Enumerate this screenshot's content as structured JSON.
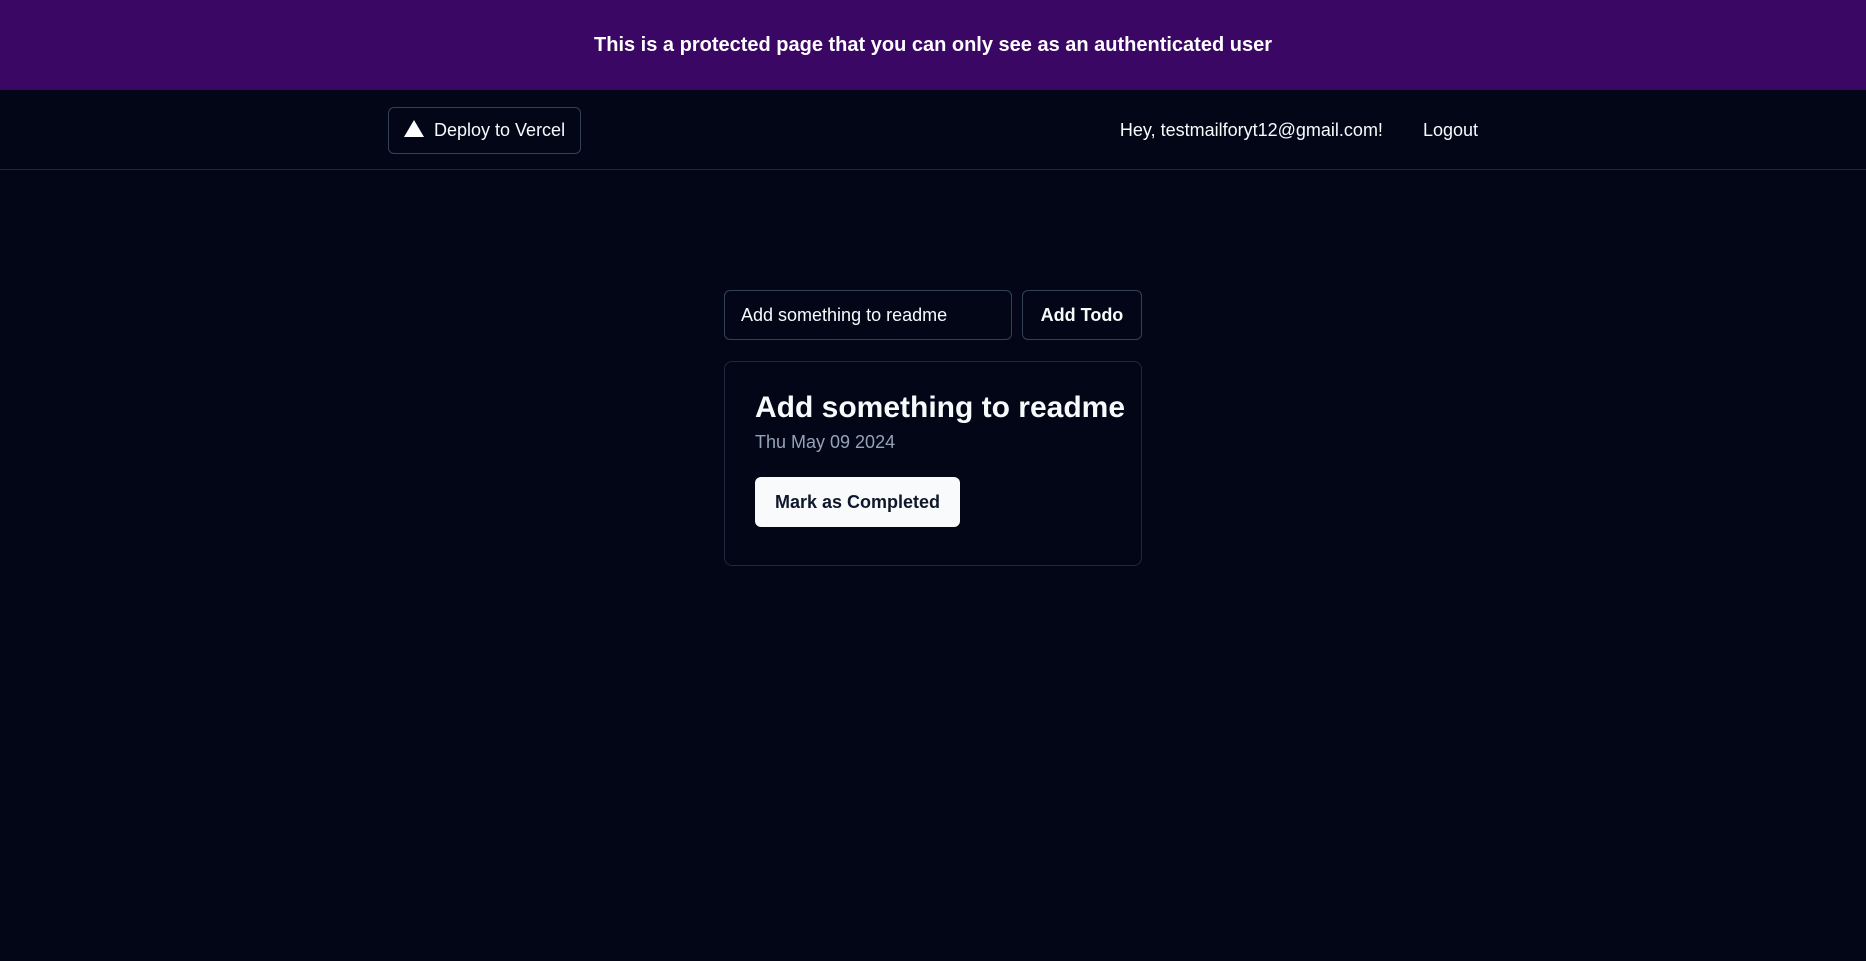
{
  "banner": {
    "text": "This is a protected page that you can only see as an authenticated user"
  },
  "navbar": {
    "deploy_label": "Deploy to Vercel",
    "deploy_icon": "triangle-icon",
    "greeting": "Hey, testmailforyt12@gmail.com!",
    "logout_label": "Logout"
  },
  "todo_form": {
    "input_value": "Add something to readme",
    "add_label": "Add Todo"
  },
  "todos": [
    {
      "title": "Add something to readme",
      "date": "Thu May 09 2024",
      "action_label": "Mark as Completed"
    }
  ],
  "colors": {
    "banner_bg": "#3b0764",
    "page_bg": "#020617",
    "muted_text": "#94a3b8"
  }
}
